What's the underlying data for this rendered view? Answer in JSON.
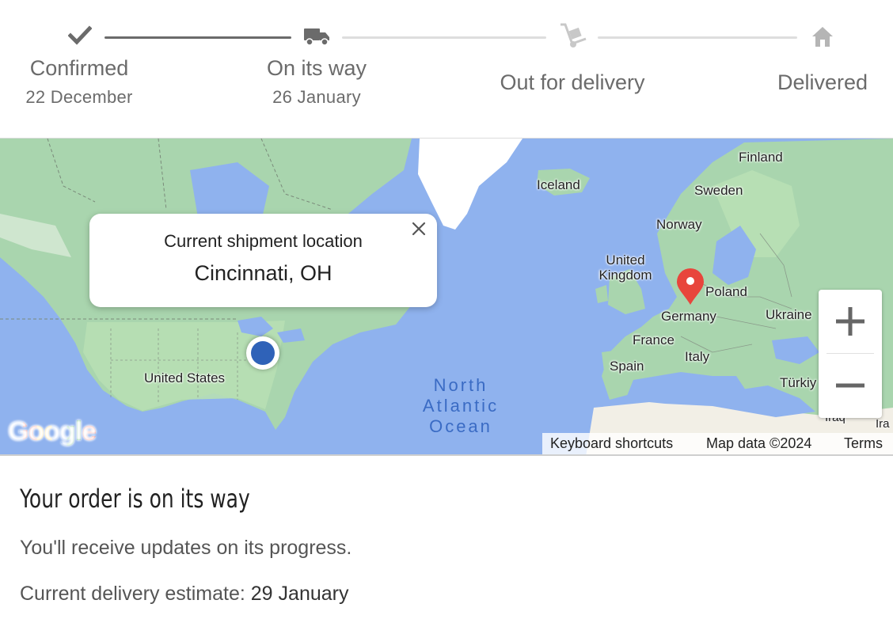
{
  "tracker": {
    "steps": [
      {
        "label": "Confirmed",
        "date": "22 December",
        "icon": "check-icon"
      },
      {
        "label": "On its way",
        "date": "26 January",
        "icon": "truck-icon"
      },
      {
        "label": "Out for delivery",
        "date": "",
        "icon": "hand-truck-icon"
      },
      {
        "label": "Delivered",
        "date": "",
        "icon": "home-icon"
      }
    ]
  },
  "map": {
    "popup": {
      "title": "Current shipment location",
      "location": "Cincinnati, OH"
    },
    "labels": {
      "finland": "Finland",
      "iceland": "Iceland",
      "sweden": "Sweden",
      "norway": "Norway",
      "united_kingdom": "United Kingdom",
      "poland": "Poland",
      "germany": "Germany",
      "ukraine": "Ukraine",
      "france": "France",
      "italy": "Italy",
      "spain": "Spain",
      "turkiye": "Türkiy",
      "iraq": "Iraq",
      "ira": "Ira",
      "united_states": "United States",
      "ocean": "North Atlantic Ocean"
    },
    "ocean_lines": [
      "North",
      "Atlantic",
      "Ocean"
    ],
    "google_logo": "Google",
    "attribution": {
      "keyboard": "Keyboard shortcuts",
      "mapdata": "Map data ©2024",
      "terms": "Terms"
    },
    "colors": {
      "water": "#8fb2ee",
      "land": "#a9d5ae",
      "marker_origin": "#2f62b8",
      "marker_destination": "#e8453c"
    }
  },
  "order": {
    "headline": "Your order is on its way",
    "subtext": "You'll receive updates on its progress.",
    "estimate_label": "Current delivery estimate: ",
    "estimate_date": "29 January"
  }
}
